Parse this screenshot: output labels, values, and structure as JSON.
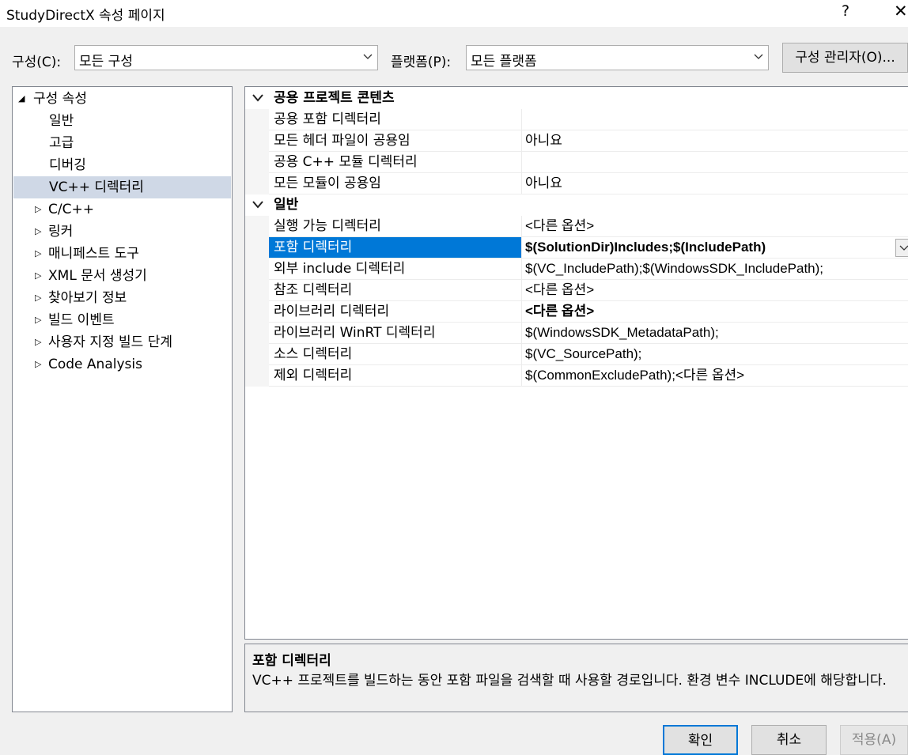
{
  "window": {
    "title": "StudyDirectX 속성 페이지",
    "help_glyph": "?",
    "close_glyph": "✕"
  },
  "toolbar": {
    "config_label": "구성(C):",
    "config_value": "모든 구성",
    "platform_label": "플랫폼(P):",
    "platform_value": "모든 플랫폼",
    "config_manager_label": "구성 관리자(O)..."
  },
  "tree": {
    "items": [
      {
        "label": "구성 속성",
        "arrow": "◢",
        "level": 0
      },
      {
        "label": "일반",
        "arrow": "",
        "level": 1
      },
      {
        "label": "고급",
        "arrow": "",
        "level": 1
      },
      {
        "label": "디버깅",
        "arrow": "",
        "level": 1
      },
      {
        "label": "VC++ 디렉터리",
        "arrow": "",
        "level": 1,
        "selected": true
      },
      {
        "label": "C/C++",
        "arrow": "▷",
        "level": 1
      },
      {
        "label": "링커",
        "arrow": "▷",
        "level": 1
      },
      {
        "label": "매니페스트 도구",
        "arrow": "▷",
        "level": 1
      },
      {
        "label": "XML 문서 생성기",
        "arrow": "▷",
        "level": 1
      },
      {
        "label": "찾아보기 정보",
        "arrow": "▷",
        "level": 1
      },
      {
        "label": "빌드 이벤트",
        "arrow": "▷",
        "level": 1
      },
      {
        "label": "사용자 지정 빌드 단계",
        "arrow": "▷",
        "level": 1
      },
      {
        "label": "Code Analysis",
        "arrow": "▷",
        "level": 1
      }
    ]
  },
  "grid": {
    "categories": [
      {
        "name": "공용 프로젝트 콘텐츠",
        "rows": [
          {
            "name": "공용 포함 디렉터리",
            "value": ""
          },
          {
            "name": "모든 헤더 파일이 공용임",
            "value": "아니요"
          },
          {
            "name": "공용 C++ 모듈 디렉터리",
            "value": ""
          },
          {
            "name": "모든 모듈이 공용임",
            "value": "아니요"
          }
        ]
      },
      {
        "name": "일반",
        "rows": [
          {
            "name": "실행 가능 디렉터리",
            "value": "<다른 옵션>"
          },
          {
            "name": "포함 디렉터리",
            "value": "$(SolutionDir)Includes;$(IncludePath)",
            "bold": true,
            "selected": true
          },
          {
            "name": "외부 include 디렉터리",
            "value": "$(VC_IncludePath);$(WindowsSDK_IncludePath);"
          },
          {
            "name": "참조 디렉터리",
            "value": "<다른 옵션>"
          },
          {
            "name": "라이브러리 디렉터리",
            "value": "<다른 옵션>",
            "bold": true
          },
          {
            "name": "라이브러리 WinRT 디렉터리",
            "value": "$(WindowsSDK_MetadataPath);"
          },
          {
            "name": "소스 디렉터리",
            "value": "$(VC_SourcePath);"
          },
          {
            "name": "제외 디렉터리",
            "value": "$(CommonExcludePath);<다른 옵션>"
          }
        ]
      }
    ]
  },
  "description": {
    "title": "포함 디렉터리",
    "text": "VC++ 프로젝트를 빌드하는 동안 포함 파일을 검색할 때 사용할 경로입니다.  환경 변수 INCLUDE에 해당합니다."
  },
  "buttons": {
    "ok": "확인",
    "cancel": "취소",
    "apply": "적용(A)"
  },
  "colors": {
    "selection": "#0078d7",
    "tree_selection": "#cfd8e6",
    "disabled_text": "#8a8a8a"
  }
}
